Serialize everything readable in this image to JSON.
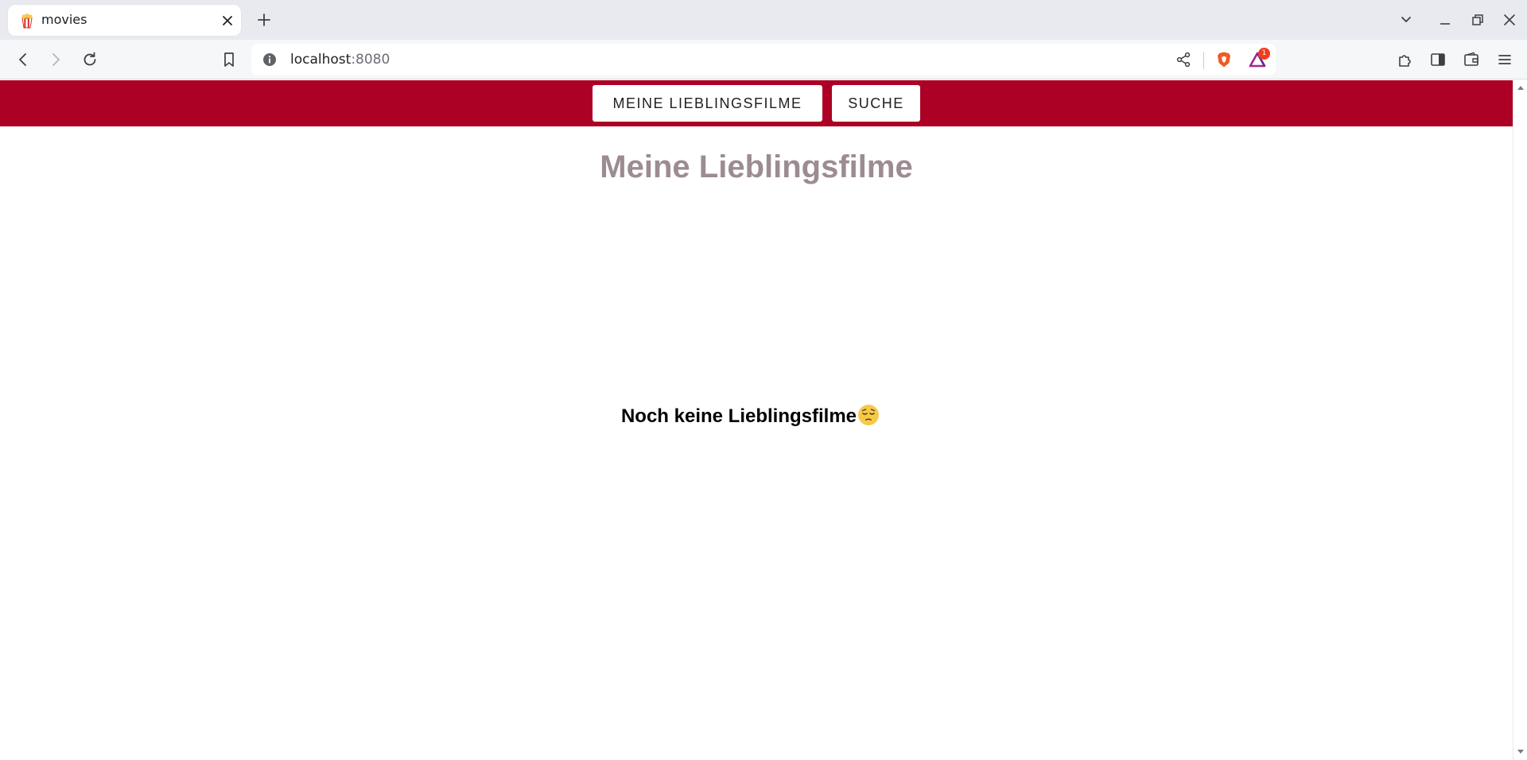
{
  "browser": {
    "tab": {
      "title": "movies",
      "favicon": "popcorn-icon"
    },
    "address": {
      "host": "localhost",
      "port": ":8080"
    },
    "shields_badge_count": "1"
  },
  "app": {
    "nav": {
      "favorites_label": "Meine Lieblingsfilme",
      "search_label": "Suche"
    },
    "page_title": "Meine Lieblingsfilme",
    "empty_message": "Noch keine Lieblingsfilme",
    "empty_emoji": "pensive-face-icon",
    "colors": {
      "navbar": "#ad0025",
      "title": "#9c8c91"
    }
  }
}
